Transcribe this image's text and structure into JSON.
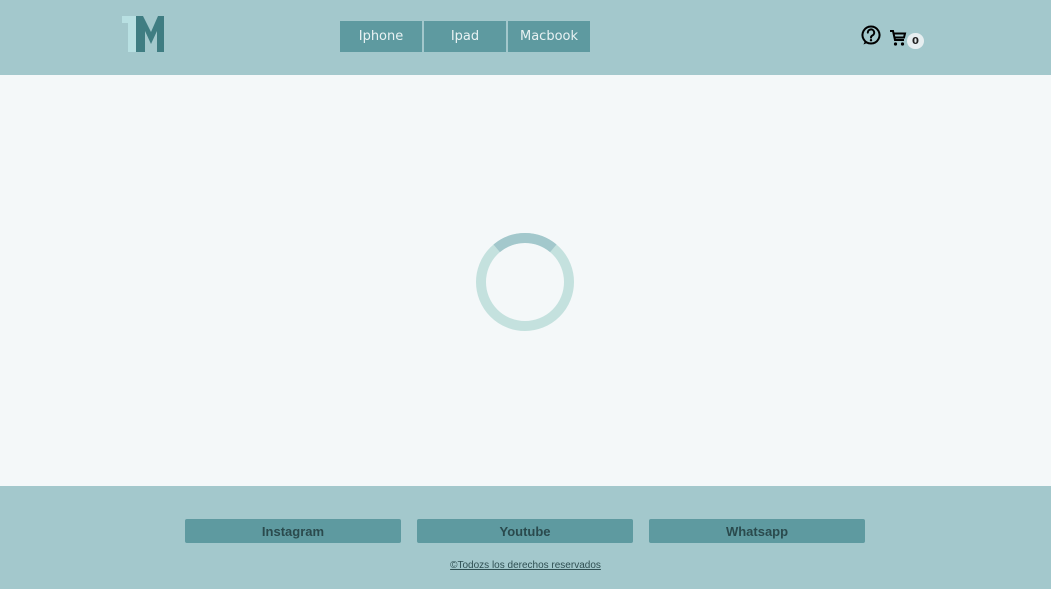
{
  "header": {
    "logo_text": "TM",
    "nav": [
      {
        "label": "Iphone"
      },
      {
        "label": "Ipad"
      },
      {
        "label": "Macbook"
      }
    ],
    "help_icon": "help-circle-icon",
    "cart_icon": "cart-icon",
    "cart_count": "0"
  },
  "main": {
    "loading_indicator": "spinner-icon"
  },
  "footer": {
    "links": [
      {
        "label": "Instagram"
      },
      {
        "label": "Youtube"
      },
      {
        "label": "Whatsapp"
      }
    ],
    "copyright": "©Todozs los derechos reservados"
  },
  "colors": {
    "header_bg": "#a3c8cc",
    "nav_bg": "#5e9aa0",
    "main_bg": "#f4f8f9",
    "logo_light": "#b8e0e2",
    "logo_dark": "#3f7d82"
  }
}
